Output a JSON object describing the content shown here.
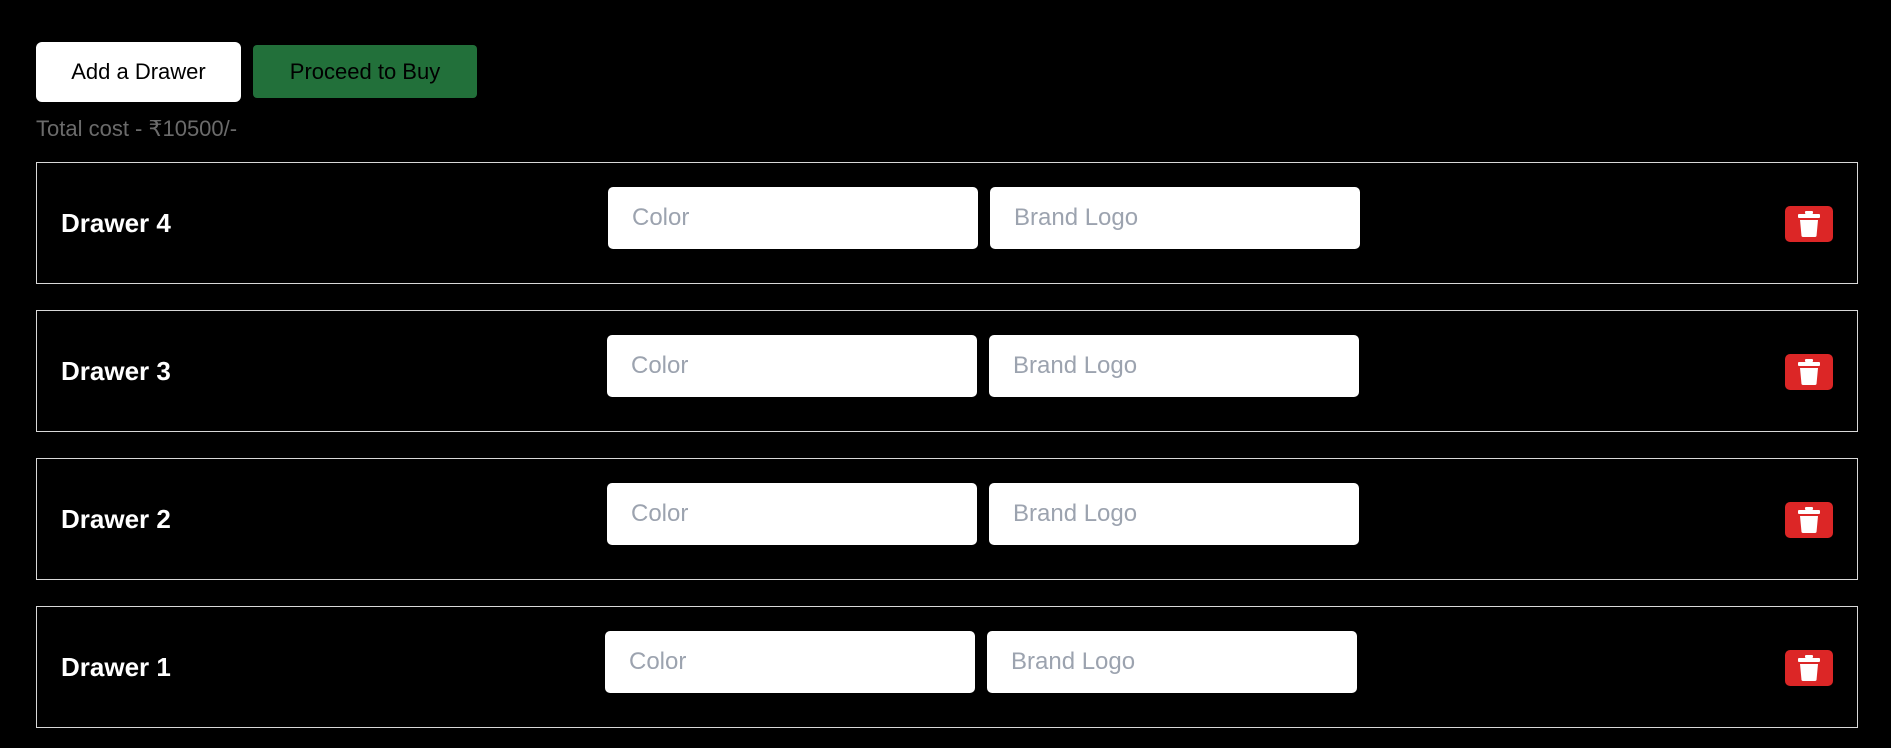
{
  "toolbar": {
    "add_label": "Add a Drawer",
    "buy_label": "Proceed to Buy"
  },
  "summary": {
    "total_text": "Total cost - ₹10500/-"
  },
  "drawers": [
    {
      "title": "Drawer 4",
      "color_placeholder": "Color",
      "color_value": "",
      "logo_placeholder": "Brand Logo",
      "logo_value": "",
      "delete_icon": "trash-icon"
    },
    {
      "title": "Drawer 3",
      "color_placeholder": "Color",
      "color_value": "",
      "logo_placeholder": "Brand Logo",
      "logo_value": "",
      "delete_icon": "trash-icon"
    },
    {
      "title": "Drawer 2",
      "color_placeholder": "Color",
      "color_value": "",
      "logo_placeholder": "Brand Logo",
      "logo_value": "",
      "delete_icon": "trash-icon"
    },
    {
      "title": "Drawer 1",
      "color_placeholder": "Color",
      "color_value": "",
      "logo_placeholder": "Brand Logo",
      "logo_value": "",
      "delete_icon": "trash-icon"
    }
  ],
  "colors": {
    "background": "#000000",
    "buy_button": "#22703a",
    "delete_button": "#dc2626",
    "total_text": "#6b6b6b",
    "row_border": "#d8d8d8"
  }
}
